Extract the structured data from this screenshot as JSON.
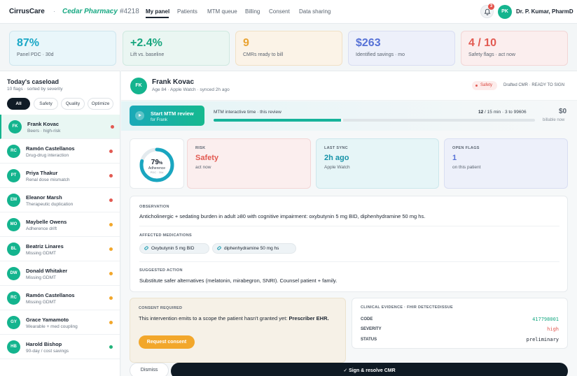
{
  "nav": {
    "brand": "CirrusCare",
    "separator": "·",
    "pharmacy": "Cedar Pharmacy",
    "store": "#4218",
    "links": [
      "My panel",
      "Patients",
      "MTM queue",
      "Billing",
      "Consent",
      "Data sharing"
    ],
    "notifications": "3",
    "user_initials": "PK",
    "user_name": "Dr. P. Kumar, PharmD"
  },
  "kpis": [
    {
      "value": "87%",
      "label": "Panel PDC · 30d"
    },
    {
      "value": "+2.4%",
      "label": "Lift vs. baseline"
    },
    {
      "value": "9",
      "label": "CMRs ready to bill"
    },
    {
      "value": "$263",
      "label": "Identified savings · mo"
    },
    {
      "value": "4 / 10",
      "label": "Safety flags · act now"
    }
  ],
  "sidebar": {
    "title": "Today's caseload",
    "subtitle": "10 flags · sorted by severity",
    "filters": [
      "All",
      "Safety",
      "Quality",
      "Optimize"
    ],
    "patients": [
      {
        "initials": "FK",
        "name": "Frank Kovac",
        "desc": "Beers · high-risk",
        "severity": "#e25a52"
      },
      {
        "initials": "RC",
        "name": "Ramón Castellanos",
        "desc": "Drug-drug interaction",
        "severity": "#e25a52"
      },
      {
        "initials": "PT",
        "name": "Priya Thakur",
        "desc": "Renal dose mismatch",
        "severity": "#e25a52"
      },
      {
        "initials": "EM",
        "name": "Eleanor Marsh",
        "desc": "Therapeutic duplication",
        "severity": "#e25a52"
      },
      {
        "initials": "MO",
        "name": "Maybelle Owens",
        "desc": "Adherence drift",
        "severity": "#f2a72b"
      },
      {
        "initials": "BL",
        "name": "Beatriz Linares",
        "desc": "Missing GDMT",
        "severity": "#f2a72b"
      },
      {
        "initials": "DW",
        "name": "Donald Whitaker",
        "desc": "Missing GDMT",
        "severity": "#f2a72b"
      },
      {
        "initials": "RC",
        "name": "Ramón Castellanos",
        "desc": "Missing GDMT",
        "severity": "#f2a72b"
      },
      {
        "initials": "GY",
        "name": "Grace Yamamoto",
        "desc": "Wearable + med coupling",
        "severity": "#f2a72b"
      },
      {
        "initials": "HB",
        "name": "Harold Bishop",
        "desc": "90-day / cost savings",
        "severity": "#22b37a"
      }
    ]
  },
  "patient": {
    "initials": "FK",
    "name": "Frank Kovac",
    "meta": "Age 84 · Apple Watch · synced 2h ago",
    "tag": "Safety",
    "status": "Drafted CMR · READY TO SIGN"
  },
  "mtm": {
    "button_title": "Start MTM review",
    "button_sub": "for Frank",
    "label": "MTM interactive time · this review",
    "count_strong": "12",
    "count_rest": " / 15 min · 3 to 99606",
    "progress": 0.4,
    "billable_value": "$0",
    "billable_label": "billable now"
  },
  "adherence": {
    "value": "79",
    "unit": "%",
    "label": "Adherence",
    "sub": "PDC · 30d",
    "fraction": 0.79
  },
  "stats": [
    {
      "title": "RISK",
      "value": "Safety",
      "sub": "act now"
    },
    {
      "title": "LAST SYNC",
      "value": "2h ago",
      "sub": "Apple Watch"
    },
    {
      "title": "OPEN FLAGS",
      "value": "1",
      "sub": "on this patient"
    }
  ],
  "observation": {
    "label": "OBSERVATION",
    "text": "Anticholinergic + sedating burden in adult ≥80 with cognitive impairment: oxybutynin 5 mg BID, diphenhydramine 50 mg hs.",
    "meds_label": "AFFECTED MEDICATIONS",
    "meds": [
      "Oxybutynin 5 mg BID",
      "diphenhydramine 50 mg hs"
    ],
    "action_label": "SUGGESTED ACTION",
    "action_text": "Substitute safer alternatives (melatonin, mirabegron, SNRI). Counsel patient + family."
  },
  "consent": {
    "label": "CONSENT REQUIRED",
    "text": "This intervention emits to a scope the patient hasn't granted yet: ",
    "scope": "Prescriber EHR.",
    "button": "Request consent"
  },
  "evidence": {
    "label": "CLINICAL EVIDENCE · FHIR DETECTEDISSUE",
    "rows": [
      {
        "key": "CODE",
        "value": "417798001",
        "color": "#16a882"
      },
      {
        "key": "SEVERITY",
        "value": "high",
        "color": "#e25a52"
      },
      {
        "key": "STATUS",
        "value": "preliminary",
        "color": "#1b2430"
      }
    ]
  },
  "actions": {
    "dismiss": "Dismiss",
    "sign": "Sign & resolve CMR"
  }
}
